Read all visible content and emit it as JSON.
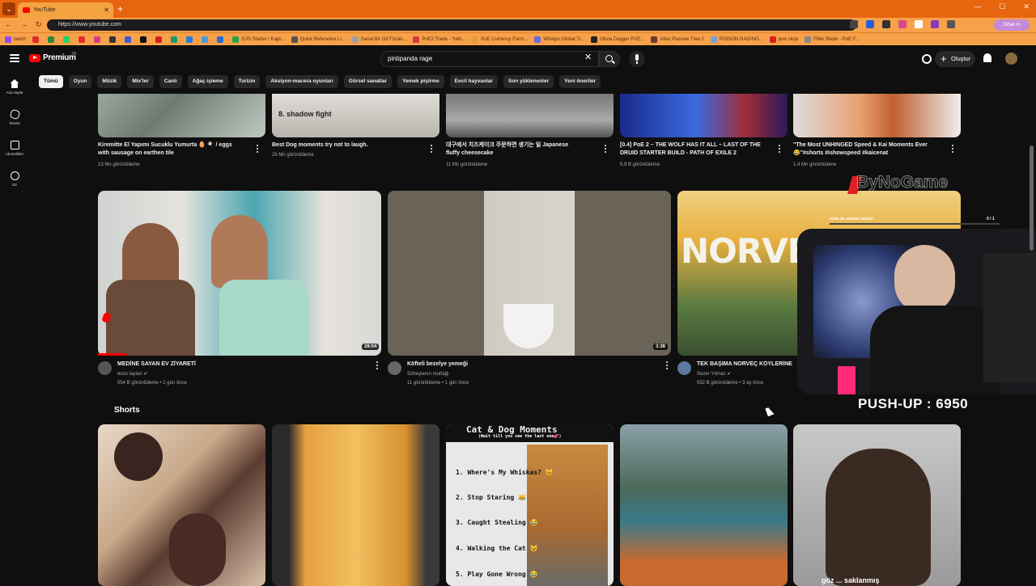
{
  "browser": {
    "tab_title": "YouTube",
    "url": "https://www.youtube.com",
    "profile_label": "Ortak m",
    "bookmarks": [
      "twitch",
      "",
      "",
      "",
      "",
      "",
      "",
      "",
      "",
      "",
      "",
      "",
      "",
      "",
      "GJS Starter / Kapl...",
      "Quick Reference Li...",
      "Sanal Bir Gif Füzak...",
      "PoE2 Trade - Yath...",
      "PoE Currency Farm...",
      "Whatps Global Tr...",
      "Olivia Dagger PVE...",
      "Atlas Passive Tree 2",
      "POISON RAGING...",
      "poe ninja",
      "Filter Blade - PoE F..."
    ]
  },
  "youtube": {
    "logo_text": "Premium",
    "region": "TR",
    "search_value": "pintipanda rage",
    "create_label": "Oluştur",
    "sidebar": [
      {
        "label": "Ana Sayfa",
        "icon": "home-icon"
      },
      {
        "label": "Shorts",
        "icon": "shorts-icon"
      },
      {
        "label": "Abonelikler",
        "icon": "subscriptions-icon"
      },
      {
        "label": "Siz",
        "icon": "you-icon"
      }
    ],
    "chips": [
      "Tümü",
      "Oyun",
      "Müzik",
      "Mix'ler",
      "Canlı",
      "Ağaç işleme",
      "Turizm",
      "Aksiyon-macera oyunları",
      "Görsel sanatlar",
      "Yemek pişirme",
      "Evcil hayvanlar",
      "Son yüklenenler",
      "Yeni öneriler"
    ],
    "row1": [
      {
        "title_line1": "Kiremitte El Yapımı Sucuklu Yumurta 🥚 🍳 / eggs",
        "title_line2": "with sausage on earthen tile",
        "meta": "13 Mn görüntüleme",
        "overlay_text": ""
      },
      {
        "title_line1": "Best Dog moments try not to laugh.",
        "title_line2": "",
        "meta": "26 Mn görüntüleme",
        "overlay_text": "8. shadow fight"
      },
      {
        "title_line1": "대구에서 치즈케이크 주문하면 생기는 일 Japanese",
        "title_line2": "fluffy cheesecake",
        "meta": "11 Mn görüntüleme",
        "overlay_text": ""
      },
      {
        "title_line1": "[0.4] PoE 2 – THE WOLF HAS IT ALL – LAST OF THE",
        "title_line2": "DRUID STARTER BUILD - PATH OF EXILE 2",
        "meta": "5,9 B görüntüleme",
        "overlay_text": ""
      },
      {
        "title_line1": "\"The Most UNHINGED Speed & Kai Moments Ever",
        "title_line2": "😂\"#shorts #ishowspeed #kaicenat",
        "meta": "1,4 Mn görüntüleme",
        "overlay_text": ""
      }
    ],
    "row2": [
      {
        "title": "MEDİNE SAYAN EV ZİYARETİ",
        "channel": "testo taylan",
        "meta": "554 B görüntüleme • 2 gün önce",
        "duration": "28:04",
        "watched_fraction": 0.1
      },
      {
        "title": "Köfteli bezelye yemeği",
        "channel": "Süheylanın mutfağı",
        "meta": "11 görüntüleme • 1 gün önce",
        "duration": "3:38",
        "watched_fraction": 0
      },
      {
        "title": "TEK BAŞIMA NORVEÇ KÖYLERİNE",
        "channel": "Sezer Yılmaz",
        "meta": "932 B görüntüleme • 3 ay önce",
        "duration": "",
        "watched_fraction": 0,
        "thumb_text": "NORVEÇ"
      }
    ],
    "shorts_heading": "Shorts",
    "shorts_overlay": {
      "title": "Cat & Dog Moments",
      "subtitle": "(Wait till you see the last one💕)",
      "items": [
        "1. Where's My Whiskas? 😼",
        "2. Stop Staring 😹",
        "3. Caught Stealing 😂",
        "4. Walking the Cat 😺",
        "5. Play Gone Wrong 😂"
      ]
    },
    "last_short_caption": "göz ... saklanmış"
  },
  "stream_overlay": {
    "watermark": "ByNoGame",
    "daily_label": "GÜNLÜK ABONE HEDEFİ",
    "daily_count": "0 / 1",
    "pushup_text": "PUSH-UP : 6950"
  },
  "colors": {
    "accent": "#ff0000",
    "tabbar": "#e8650f",
    "toolbar": "#f7a14a",
    "background": "#0f0f0f"
  }
}
